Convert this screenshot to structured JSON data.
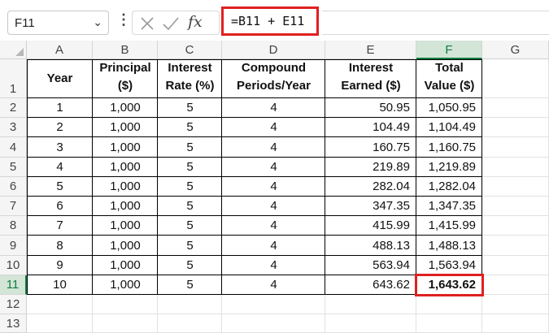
{
  "formula_bar": {
    "name_box": "F11",
    "name_box_arrow": "⌄",
    "menu_dots": "⋮",
    "fx_label": "fx",
    "formula": "=B11 + E11"
  },
  "columns": [
    "A",
    "B",
    "C",
    "D",
    "E",
    "F",
    "G"
  ],
  "selected_column": "F",
  "rows": [
    "1",
    "2",
    "3",
    "4",
    "5",
    "6",
    "7",
    "8",
    "9",
    "10",
    "11",
    "12",
    "13"
  ],
  "selected_row": "11",
  "table": {
    "headers": {
      "year": "Year",
      "principal_1": "Principal",
      "principal_2": "($)",
      "rate_1": "Interest",
      "rate_2": "Rate (%)",
      "periods_1": "Compound",
      "periods_2": "Periods/Year",
      "earned_1": "Interest",
      "earned_2": "Earned ($)",
      "total_1": "Total",
      "total_2": "Value ($)"
    },
    "rows": [
      {
        "year": "1",
        "principal": "1,000",
        "rate": "5",
        "periods": "4",
        "earned": "50.95",
        "total": "1,050.95"
      },
      {
        "year": "2",
        "principal": "1,000",
        "rate": "5",
        "periods": "4",
        "earned": "104.49",
        "total": "1,104.49"
      },
      {
        "year": "3",
        "principal": "1,000",
        "rate": "5",
        "periods": "4",
        "earned": "160.75",
        "total": "1,160.75"
      },
      {
        "year": "4",
        "principal": "1,000",
        "rate": "5",
        "periods": "4",
        "earned": "219.89",
        "total": "1,219.89"
      },
      {
        "year": "5",
        "principal": "1,000",
        "rate": "5",
        "periods": "4",
        "earned": "282.04",
        "total": "1,282.04"
      },
      {
        "year": "6",
        "principal": "1,000",
        "rate": "5",
        "periods": "4",
        "earned": "347.35",
        "total": "1,347.35"
      },
      {
        "year": "7",
        "principal": "1,000",
        "rate": "5",
        "periods": "4",
        "earned": "415.99",
        "total": "1,415.99"
      },
      {
        "year": "8",
        "principal": "1,000",
        "rate": "5",
        "periods": "4",
        "earned": "488.13",
        "total": "1,488.13"
      },
      {
        "year": "9",
        "principal": "1,000",
        "rate": "5",
        "periods": "4",
        "earned": "563.94",
        "total": "1,563.94"
      },
      {
        "year": "10",
        "principal": "1,000",
        "rate": "5",
        "periods": "4",
        "earned": "643.62",
        "total": "1,643.62"
      }
    ]
  },
  "colors": {
    "highlight": "#e02020",
    "selected_header_bg": "#d3e5d6",
    "selected_header_text": "#107c41"
  }
}
